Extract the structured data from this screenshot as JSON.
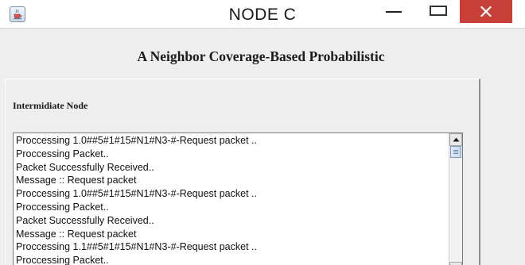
{
  "window": {
    "title": "NODE C",
    "icon": "java-cup-icon",
    "controls": [
      "minimize-icon",
      "maximize-icon",
      "close-icon"
    ],
    "close_color": "#c84038"
  },
  "header": {
    "title": "A Neighbor Coverage-Based Probabilistic"
  },
  "panel": {
    "label": "Intermidiate Node",
    "log_lines": [
      "Proccessing 1.0##5#1#15#N1#N3-#-Request packet ..",
      "Proccessing Packet..",
      "Packet Successfully Received..",
      "Message :: Request packet",
      "Proccessing 1.0##5#1#15#N1#N3-#-Request packet ..",
      "Proccessing Packet..",
      "Packet Successfully Received..",
      "Message :: Request packet",
      "Proccessing 1.1##5#1#15#N1#N3-#-Request packet ..",
      "Proccessing Packet.."
    ]
  }
}
